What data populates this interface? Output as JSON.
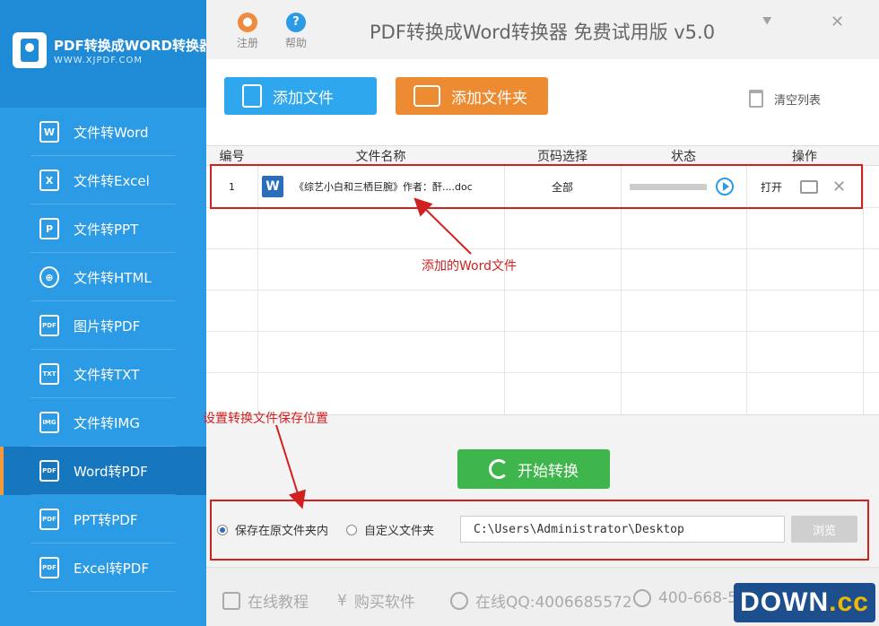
{
  "app": {
    "brand_name": "PDF转换成WORD转换器",
    "brand_url": "WWW.XJPDF.COM",
    "title": "PDF转换成Word转换器 免费试用版 v5.0"
  },
  "titlebar": {
    "register_label": "注册",
    "help_label": "帮助",
    "minimize_glyph": "⯆",
    "close_glyph": "✕"
  },
  "sidebar": {
    "items": [
      {
        "label": "文件转Word",
        "icon": "W"
      },
      {
        "label": "文件转Excel",
        "icon": "X"
      },
      {
        "label": "文件转PPT",
        "icon": "P"
      },
      {
        "label": "文件转HTML",
        "icon": "⊕"
      },
      {
        "label": "图片转PDF",
        "icon": "PDF"
      },
      {
        "label": "文件转TXT",
        "icon": "TXT"
      },
      {
        "label": "文件转IMG",
        "icon": "IMG"
      },
      {
        "label": "Word转PDF",
        "icon": "PDF"
      },
      {
        "label": "PPT转PDF",
        "icon": "PDF"
      },
      {
        "label": "Excel转PDF",
        "icon": "PDF"
      }
    ],
    "active_index": 7
  },
  "toolbar": {
    "add_file_label": "添加文件",
    "add_folder_label": "添加文件夹",
    "clear_list_label": "清空列表"
  },
  "table": {
    "headers": [
      "编号",
      "文件名称",
      "页码选择",
      "状态",
      "操作"
    ],
    "rows": [
      {
        "index": "1",
        "icon": "W",
        "filename": "《综艺小白和三栖巨腕》作者：酐....doc",
        "pages": "全部",
        "progress": 0,
        "open_label": "打开"
      }
    ]
  },
  "annotations": {
    "added_file": "添加的Word文件",
    "save_location": "设置转换文件保存位置"
  },
  "convert": {
    "start_label": "开始转换"
  },
  "save": {
    "original_folder_label": "保存在原文件夹内",
    "custom_folder_label": "自定义文件夹",
    "path": "C:\\Users\\Administrator\\Desktop",
    "browse_label": "浏览",
    "selected": "original"
  },
  "footer": {
    "tutorial_label": "在线教程",
    "buy_label": "购买软件",
    "qq_label": "在线QQ:4006685572",
    "phone_label": "400-668-55"
  },
  "watermark": {
    "text": "DOWN",
    "suffix": ".cc"
  },
  "colors": {
    "sidebar": "#2c9be6",
    "active_item": "#1677bf",
    "add_file_button": "#2ea7ee",
    "add_folder_button": "#ed8b32",
    "start_button": "#3fb64b",
    "annotation": "#d21f1f"
  }
}
